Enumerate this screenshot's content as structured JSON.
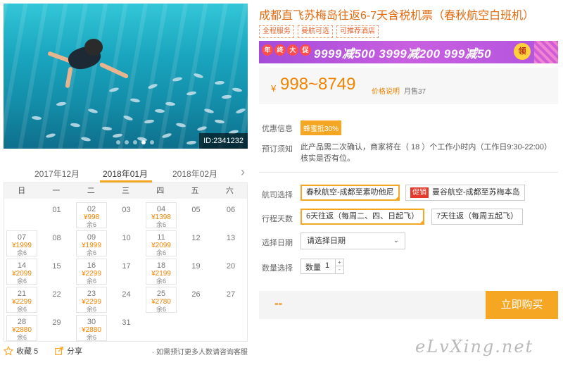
{
  "photo": {
    "id_label": "ID:2341232",
    "slide_count": 5,
    "active_slide": 3
  },
  "calendar": {
    "months": {
      "prev": "2017年12月",
      "current": "2018年01月",
      "next": "2018年02月"
    },
    "weekdays": [
      "日",
      "一",
      "二",
      "三",
      "四",
      "五",
      "六"
    ],
    "currency": "¥",
    "cells": [
      {
        "day": "01",
        "col": 1,
        "row": 0
      },
      {
        "day": "02",
        "col": 2,
        "row": 0,
        "price": "998",
        "stock": "余6"
      },
      {
        "day": "03",
        "col": 3,
        "row": 0
      },
      {
        "day": "04",
        "col": 4,
        "row": 0,
        "price": "1398",
        "stock": "余6"
      },
      {
        "day": "05",
        "col": 5,
        "row": 0
      },
      {
        "day": "06",
        "col": 6,
        "row": 0
      },
      {
        "day": "07",
        "col": 0,
        "row": 1,
        "price": "1999",
        "stock": "余6"
      },
      {
        "day": "08",
        "col": 1,
        "row": 1
      },
      {
        "day": "09",
        "col": 2,
        "row": 1,
        "price": "1999",
        "stock": "余6"
      },
      {
        "day": "10",
        "col": 3,
        "row": 1
      },
      {
        "day": "11",
        "col": 4,
        "row": 1,
        "price": "2099",
        "stock": "余6"
      },
      {
        "day": "12",
        "col": 5,
        "row": 1
      },
      {
        "day": "13",
        "col": 6,
        "row": 1
      },
      {
        "day": "14",
        "col": 0,
        "row": 2,
        "price": "2099",
        "stock": "余6"
      },
      {
        "day": "15",
        "col": 1,
        "row": 2
      },
      {
        "day": "16",
        "col": 2,
        "row": 2,
        "price": "2299",
        "stock": "余6"
      },
      {
        "day": "17",
        "col": 3,
        "row": 2
      },
      {
        "day": "18",
        "col": 4,
        "row": 2,
        "price": "2199",
        "stock": "余6"
      },
      {
        "day": "19",
        "col": 5,
        "row": 2
      },
      {
        "day": "20",
        "col": 6,
        "row": 2
      },
      {
        "day": "21",
        "col": 0,
        "row": 3,
        "price": "2299",
        "stock": "余6"
      },
      {
        "day": "22",
        "col": 1,
        "row": 3
      },
      {
        "day": "23",
        "col": 2,
        "row": 3,
        "price": "2299",
        "stock": "余6"
      },
      {
        "day": "24",
        "col": 3,
        "row": 3
      },
      {
        "day": "25",
        "col": 4,
        "row": 3,
        "price": "2780",
        "stock": "余6"
      },
      {
        "day": "26",
        "col": 5,
        "row": 3
      },
      {
        "day": "27",
        "col": 6,
        "row": 3
      },
      {
        "day": "28",
        "col": 0,
        "row": 4,
        "price": "2880",
        "stock": "余6"
      },
      {
        "day": "29",
        "col": 1,
        "row": 4
      },
      {
        "day": "30",
        "col": 2,
        "row": 4,
        "price": "2880",
        "stock": "余6"
      },
      {
        "day": "31",
        "col": 3,
        "row": 4
      }
    ]
  },
  "footer": {
    "favorite_label": "收藏 5",
    "share_label": "分享",
    "note": "· 如需预订更多人数请咨询客服"
  },
  "product": {
    "title": "成都直飞苏梅岛往返6-7天含税机票（春秋航空白班机）",
    "tags": [
      "全程服务",
      "曼航可选",
      "可推荐酒店"
    ],
    "promo": {
      "badge_chars": [
        "年",
        "终",
        "大",
        "促"
      ],
      "offers": "9999减500  3999减200  999减50",
      "coin": "领"
    },
    "price": {
      "currency": "¥",
      "range": "998~8749",
      "explain_link": "价格说明",
      "sold": "月售37"
    },
    "discount": {
      "label": "优惠信息",
      "chip": "蜂蜜抵30%"
    },
    "notice": {
      "label": "预订须知",
      "text": "此产品需二次确认，商家将在（ 18 ）个工作小时内（工作日9:30-22:00）核实是否有位。"
    },
    "route": {
      "label": "航司选择",
      "options": [
        {
          "text": "春秋航空-成都至素叻他尼",
          "selected": true
        },
        {
          "promo_tag": "促销",
          "text": "曼谷航空-成都至苏梅本岛",
          "selected": false
        }
      ]
    },
    "duration": {
      "label": "行程天数",
      "options": [
        {
          "text": "6天往返（每周二、四、日起飞）",
          "selected": true
        },
        {
          "text": "7天往返（每周五起飞）",
          "selected": false
        }
      ]
    },
    "date": {
      "label": "选择日期",
      "placeholder": "请选择日期"
    },
    "quantity": {
      "label": "数量选择",
      "field_label": "数量",
      "value": "1",
      "up": "+",
      "down": "-"
    },
    "total": "--",
    "buy_label": "立即购买"
  },
  "watermark": "eLvXing.net",
  "colors": {
    "accent": "#f5a623",
    "price": "#f08400",
    "title": "#e06a0f",
    "promo_bg": "#b054de",
    "promo_tag": "#e4392b"
  }
}
